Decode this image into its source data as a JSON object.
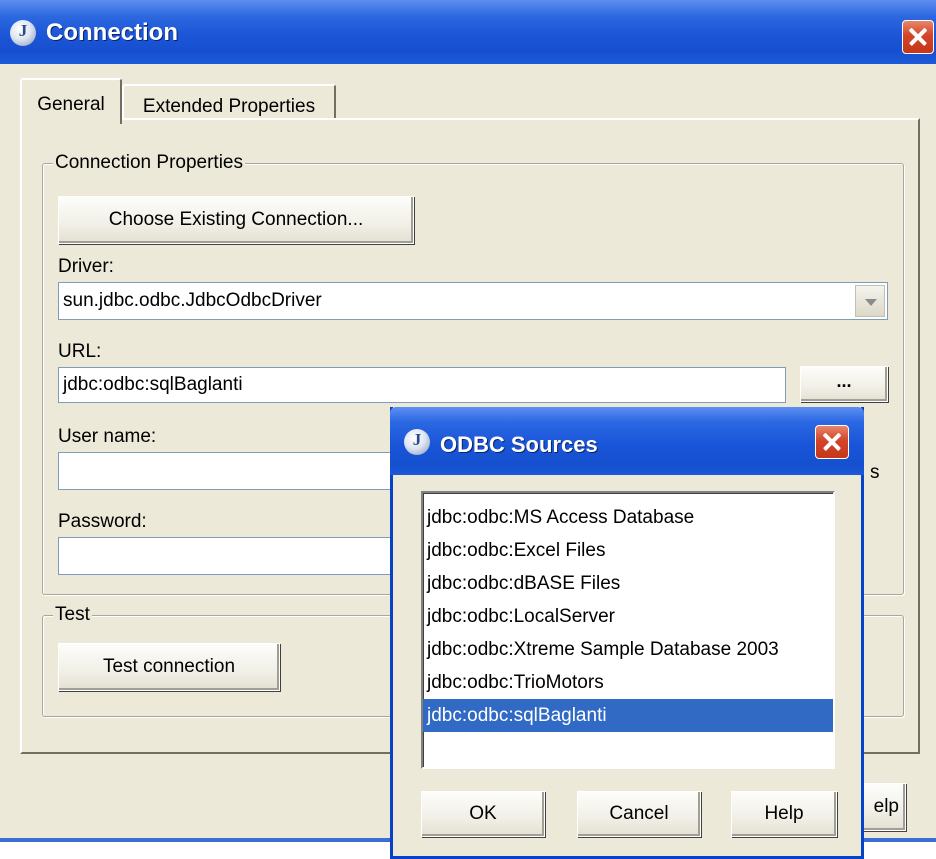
{
  "main_window": {
    "title": "Connection",
    "tabs": [
      {
        "label": "General",
        "active": true
      },
      {
        "label": "Extended Properties",
        "active": false
      }
    ],
    "connection_properties": {
      "legend": "Connection Properties",
      "choose_button": "Choose Existing Connection...",
      "driver_label": "Driver:",
      "driver_value": "sun.jdbc.odbc.JdbcOdbcDriver",
      "url_label": "URL:",
      "url_value": "jdbc:odbc:sqlBaglanti",
      "browse_button": "...",
      "username_label": "User name:",
      "username_value": "",
      "password_label": "Password:",
      "password_value": "",
      "partial_text": "s"
    },
    "test": {
      "legend": "Test",
      "test_button": "Test connection"
    },
    "help_button_partial": "elp"
  },
  "odbc_dialog": {
    "title": "ODBC Sources",
    "sources": [
      "jdbc:odbc:MS Access Database",
      "jdbc:odbc:Excel Files",
      "jdbc:odbc:dBASE Files",
      "jdbc:odbc:LocalServer",
      "jdbc:odbc:Xtreme Sample Database 2003",
      "jdbc:odbc:TrioMotors",
      "jdbc:odbc:sqlBaglanti"
    ],
    "selected_index": 6,
    "ok_button": "OK",
    "cancel_button": "Cancel",
    "help_button": "Help"
  },
  "colors": {
    "titlebar_blue": "#1c56d8",
    "selection_blue": "#316ac5",
    "dialog_face": "#ece9d8",
    "close_red": "#d3442a"
  },
  "icons": [
    "java-app-icon",
    "close-icon",
    "dropdown-arrow-icon"
  ]
}
